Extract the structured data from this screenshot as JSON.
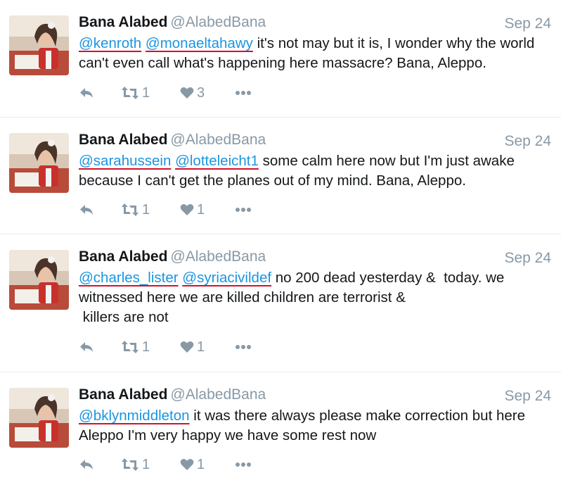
{
  "tweets": [
    {
      "name": "Bana Alabed",
      "handle": "@AlabedBana",
      "date": "Sep 24",
      "mentions": [
        "@kenroth",
        "@monaeltahawy"
      ],
      "body": " it's not may but it is, I wonder why the world can't even call what's happening here massacre? Bana, Aleppo.",
      "retweets": "1",
      "likes": "3"
    },
    {
      "name": "Bana Alabed",
      "handle": "@AlabedBana",
      "date": "Sep 24",
      "mentions": [
        "@sarahussein",
        "@lotteleicht1"
      ],
      "body": " some calm here now but I'm just awake because I can't get the planes out of my mind. Bana, Aleppo.",
      "retweets": "1",
      "likes": "1"
    },
    {
      "name": "Bana Alabed",
      "handle": "@AlabedBana",
      "date": "Sep 24",
      "mentions": [
        "@charles_lister",
        "@syriacivildef"
      ],
      "body": " no 200 dead yesterday &  today. we witnessed here we are killed children are terrorist &\n killers are not",
      "retweets": "1",
      "likes": "1"
    },
    {
      "name": "Bana Alabed",
      "handle": "@AlabedBana",
      "date": "Sep 24",
      "mentions": [
        "@bklynmiddleton"
      ],
      "body": " it was there always please make correction but here Aleppo I'm very happy we have some rest now",
      "retweets": "1",
      "likes": "1"
    }
  ],
  "icons": {
    "reply": "reply-icon",
    "retweet": "retweet-icon",
    "like": "heart-icon",
    "more": "more-icon"
  },
  "colors": {
    "mention": "#1b95e0",
    "underline": "#d3122b",
    "muted": "#8899a6"
  }
}
